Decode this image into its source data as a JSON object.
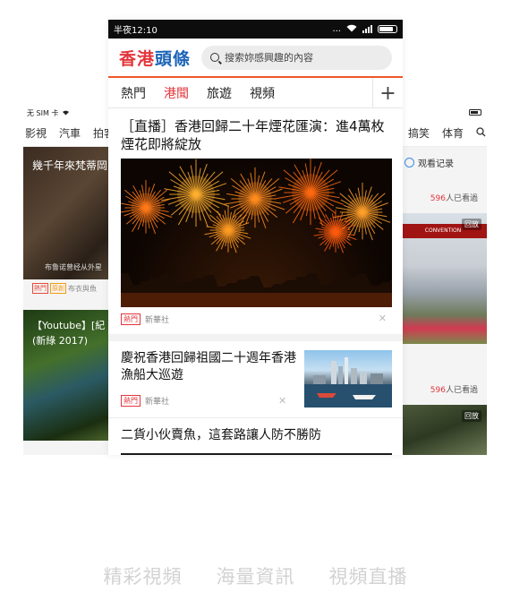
{
  "left_phone": {
    "status_carrier": "无 SIM 卡",
    "tabs": [
      "影視",
      "汽車",
      "拍客"
    ],
    "card1_title": "幾千年來梵蒂岡",
    "card1_subtitle": "布鲁诺曾经从外星",
    "card1_tags": [
      "熱門",
      "原創"
    ],
    "card1_source": "布衣與魚",
    "card2_title": "【Youtube】[紀",
    "card2_title2": "(新綠 2017)"
  },
  "right_phone": {
    "tabs": [
      "搞笑",
      "体育"
    ],
    "history_label": "观看记录",
    "viewers1_count": "596",
    "viewers1_suffix": "人已看過",
    "replay1": "回放",
    "banner_text": "CONVENTION",
    "viewers2_count": "596",
    "viewers2_suffix": "人已看過",
    "replay2": "回放"
  },
  "main_phone": {
    "status_time": "半夜12:10",
    "status_dots": "...",
    "logo_part1": "香港",
    "logo_part2": "頭條",
    "search_placeholder": "搜索妳感興趣的內容",
    "nav_tabs": [
      {
        "label": "熱門",
        "active": false
      },
      {
        "label": "港聞",
        "active": true
      },
      {
        "label": "旅遊",
        "active": false
      },
      {
        "label": "視頻",
        "active": false
      }
    ],
    "nav_add": "+",
    "articles": [
      {
        "title": "［直播］香港回歸二十年煙花匯演：進4萬枚煙花即將綻放",
        "tag": "熱門",
        "source": "新華社",
        "close": "✕"
      },
      {
        "title": "慶祝香港回歸祖國二十週年香港漁船大巡遊",
        "tag": "熱門",
        "source": "新華社",
        "close": "✕"
      },
      {
        "title": "二貨小伙賣魚，這套路讓人防不勝防"
      }
    ]
  },
  "bottom_captions": [
    "精彩視頻",
    "海量資訊",
    "視頻直播"
  ],
  "colors": {
    "accent_red": "#e2363c",
    "logo_blue": "#1b63b6",
    "tab_underline_orange": "#f0572a"
  }
}
